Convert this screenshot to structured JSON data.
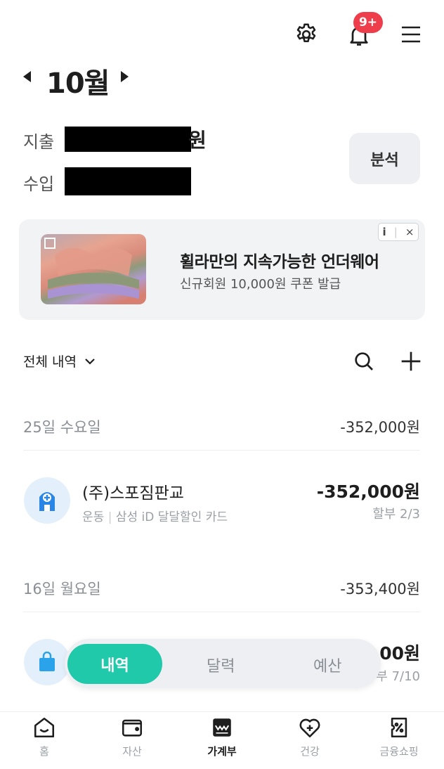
{
  "header": {
    "badge": "9+",
    "icons": [
      "gear-icon",
      "bell-icon",
      "menu-icon"
    ]
  },
  "month": {
    "label": "10월"
  },
  "summary": {
    "expense_label": "지출",
    "expense_suffix": "원",
    "income_label": "수입",
    "analysis_button": "분석"
  },
  "ad": {
    "title": "휠라만의 지속가능한 언더웨어",
    "subtitle": "신규회원 10,000원 쿠폰 발급",
    "info": "i",
    "close": "×"
  },
  "filter": {
    "label": "전체 내역"
  },
  "days": [
    {
      "date": "25일 수요일",
      "total": "-352,000원",
      "transactions": [
        {
          "merchant": "(주)스포짐판교",
          "category": "운동",
          "card": "삼성 iD 달달할인 카드",
          "amount": "-352,000원",
          "installment": "할부 2/3"
        }
      ]
    },
    {
      "date": "16일 월요일",
      "total": "-353,400원",
      "transactions": [
        {
          "amount_partial": "00원",
          "installment_partial": "부 7/10"
        }
      ]
    }
  ],
  "segment": {
    "items": [
      "내역",
      "달력",
      "예산"
    ],
    "active": "내역"
  },
  "bottom_nav": {
    "items": [
      "홈",
      "자산",
      "가계부",
      "건강",
      "금융쇼핑"
    ],
    "active": "가계부"
  },
  "colors": {
    "accent": "#1fc9a9",
    "badge": "#ee3e4b"
  }
}
